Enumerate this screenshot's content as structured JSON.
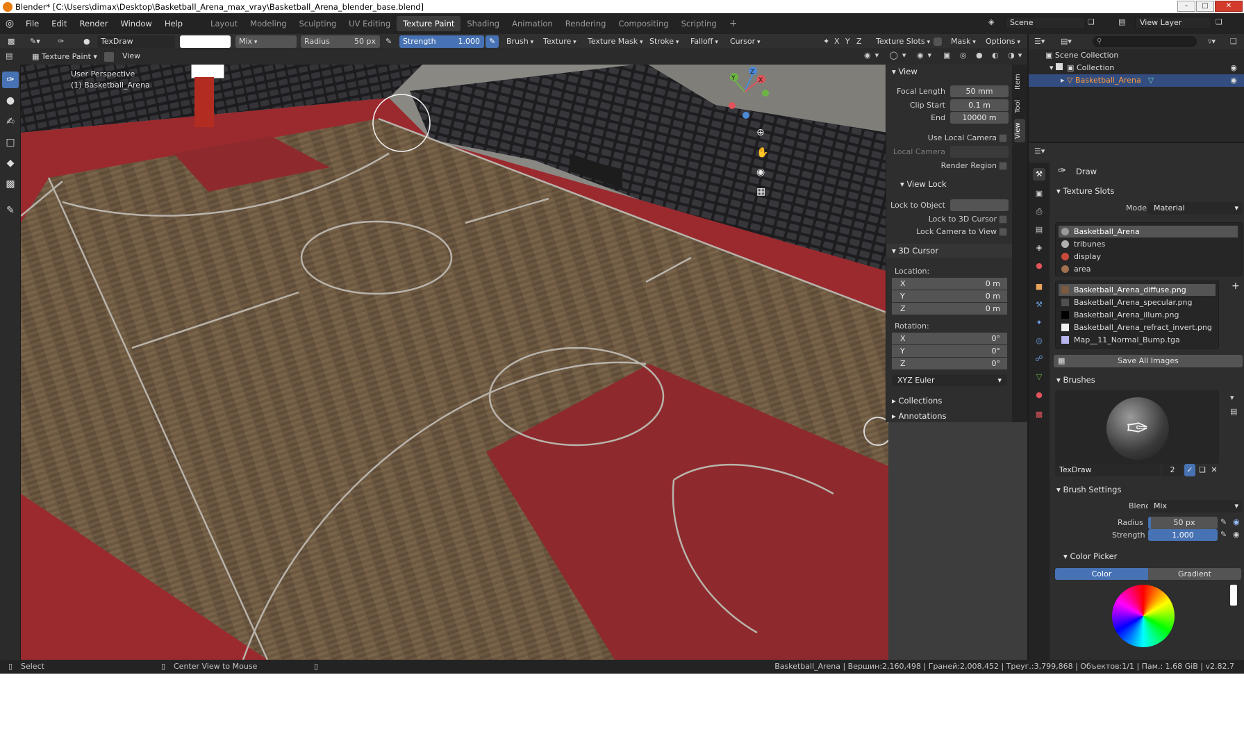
{
  "window": {
    "title": "Blender* [C:\\Users\\dimax\\Desktop\\Basketball_Arena_max_vray\\Basketball_Arena_blender_base.blend]",
    "minimize_icon": "minimize-icon",
    "maximize_icon": "maximize-icon",
    "close_icon": "close-icon"
  },
  "menus": [
    "File",
    "Edit",
    "Render",
    "Window",
    "Help"
  ],
  "workspaces": [
    "Layout",
    "Modeling",
    "Sculpting",
    "UV Editing",
    "Texture Paint",
    "Shading",
    "Animation",
    "Rendering",
    "Compositing",
    "Scripting"
  ],
  "active_workspace": "Texture Paint",
  "add_workspace": "+",
  "scene": {
    "label": "Scene",
    "view_layer": "View Layer"
  },
  "header": {
    "brush_name": "TexDraw",
    "blend_mode": "Mix",
    "radius_label": "Radius",
    "radius_value": "50 px",
    "strength_label": "Strength",
    "strength_value": "1.000",
    "dropdowns": [
      "Brush",
      "Texture",
      "Texture Mask",
      "Stroke",
      "Falloff",
      "Cursor"
    ],
    "axes": [
      "X",
      "Y",
      "Z"
    ],
    "texture_slots": "Texture Slots",
    "mask": "Mask",
    "options": "Options"
  },
  "tool_header": {
    "mode": "Texture Paint",
    "view": "View"
  },
  "viewport": {
    "perspective": "User Perspective",
    "object": "(1) Basketball_Arena",
    "gizmo_axes": [
      "X",
      "Y",
      "Z"
    ]
  },
  "toolbar": {
    "tools": [
      "draw-tool",
      "soften-tool",
      "smear-tool",
      "clone-tool",
      "fill-tool",
      "mask-tool",
      "annotate-tool"
    ]
  },
  "npanel": {
    "tabs": [
      "Item",
      "Tool",
      "View"
    ],
    "active_tab": "View",
    "view_section": "View",
    "focal_length_label": "Focal Length",
    "focal_length": "50 mm",
    "clip_start_label": "Clip Start",
    "clip_start": "0.1 m",
    "end_label": "End",
    "end": "10000 m",
    "use_local_camera": "Use Local Camera",
    "local_camera": "Local Camera",
    "render_region": "Render Region",
    "view_lock": "View Lock",
    "lock_to_object": "Lock to Object",
    "lock_to_3d_cursor": "Lock to 3D Cursor",
    "lock_camera_to_view": "Lock Camera to View",
    "cursor_section": "3D Cursor",
    "location_label": "Location:",
    "location": [
      {
        "axis": "X",
        "value": "0 m"
      },
      {
        "axis": "Y",
        "value": "0 m"
      },
      {
        "axis": "Z",
        "value": "0 m"
      }
    ],
    "rotation_label": "Rotation:",
    "rotation": [
      {
        "axis": "X",
        "value": "0°"
      },
      {
        "axis": "Y",
        "value": "0°"
      },
      {
        "axis": "Z",
        "value": "0°"
      }
    ],
    "rotation_mode": "XYZ Euler",
    "collections": "Collections",
    "annotations": "Annotations"
  },
  "outliner": {
    "scene_collection": "Scene Collection",
    "collection": "Collection",
    "object": "Basketball_Arena"
  },
  "properties": {
    "tool_name": "Draw",
    "texture_slots_section": "Texture Slots",
    "mode_label": "Mode",
    "mode_value": "Material",
    "materials": [
      {
        "name": "Basketball_Arena",
        "color": "#9a9a9a"
      },
      {
        "name": "tribunes",
        "color": "#b0b0b0"
      },
      {
        "name": "display",
        "color": "#c84a3a"
      },
      {
        "name": "area",
        "color": "#a07050"
      }
    ],
    "images": [
      {
        "name": "Basketball_Arena_diffuse.png",
        "color": "#7a5a40"
      },
      {
        "name": "Basketball_Arena_specular.png",
        "color": "#505050"
      },
      {
        "name": "Basketball_Arena_illum.png",
        "color": "#000000"
      },
      {
        "name": "Basketball_Arena_refract_invert.png",
        "color": "#f0f0f0"
      },
      {
        "name": "Map__11_Normal_Bump.tga",
        "color": "#b8b4ee"
      }
    ],
    "save_all_images": "Save All Images",
    "brushes_section": "Brushes",
    "brush_name": "TexDraw",
    "brush_users": "2",
    "brush_settings_section": "Brush Settings",
    "blend_label": "Blend",
    "blend_value": "Mix",
    "radius_label": "Radius",
    "radius_value": "50 px",
    "strength_label": "Strength",
    "strength_value": "1.000",
    "color_picker_section": "Color Picker",
    "color_tab": "Color",
    "gradient_tab": "Gradient"
  },
  "statusbar": {
    "select": "Select",
    "center_view": "Center View to Mouse",
    "stats": "Basketball_Arena | Вершин:2,160,498 | Граней:2,008,452 | Треуг.:3,799,868 | Объектов:1/1 | Пам.: 1.68 GiB | v2.82.7"
  },
  "colors": {
    "accent": "#4772b3",
    "court_red": "#8e2a2d",
    "floor": "#6e5a42",
    "seats": "#2a2a2c"
  }
}
